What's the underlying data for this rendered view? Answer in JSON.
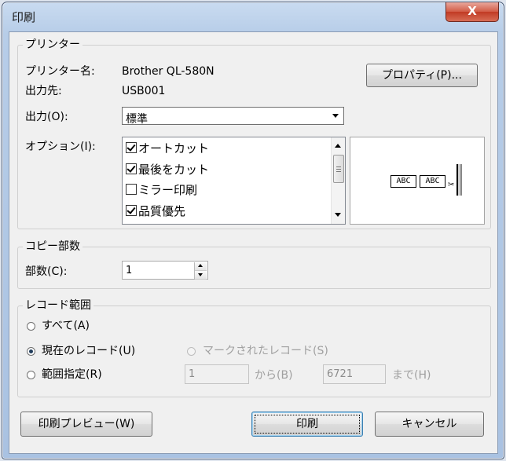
{
  "window": {
    "title": "印刷",
    "close_label": "X"
  },
  "printer": {
    "group_title": "プリンター",
    "name_label": "プリンター名:",
    "name_value": "Brother QL-580N",
    "port_label": "出力先:",
    "port_value": "USB001",
    "properties_button": "プロパティ(P)...",
    "output_label": "出力(O):",
    "output_value": "標準",
    "options_label": "オプション(I):",
    "options": [
      {
        "label": "オートカット",
        "checked": true
      },
      {
        "label": "最後をカット",
        "checked": true
      },
      {
        "label": "ミラー印刷",
        "checked": false
      },
      {
        "label": "品質優先",
        "checked": true
      }
    ],
    "preview_label_1": "ABC",
    "preview_label_2": "ABC"
  },
  "copies": {
    "group_title": "コピー部数",
    "count_label": "部数(C):",
    "count_value": "1"
  },
  "record_range": {
    "group_title": "レコード範囲",
    "all_label": "すべて(A)",
    "current_label": "現在のレコード(U)",
    "marked_label": "マークされたレコード(S)",
    "range_label": "範囲指定(R)",
    "from_value": "1",
    "from_label": "から(B)",
    "to_value": "6721",
    "to_label": "まで(H)",
    "selected": "current"
  },
  "buttons": {
    "preview": "印刷プレビュー(W)",
    "print": "印刷",
    "cancel": "キャンセル"
  }
}
